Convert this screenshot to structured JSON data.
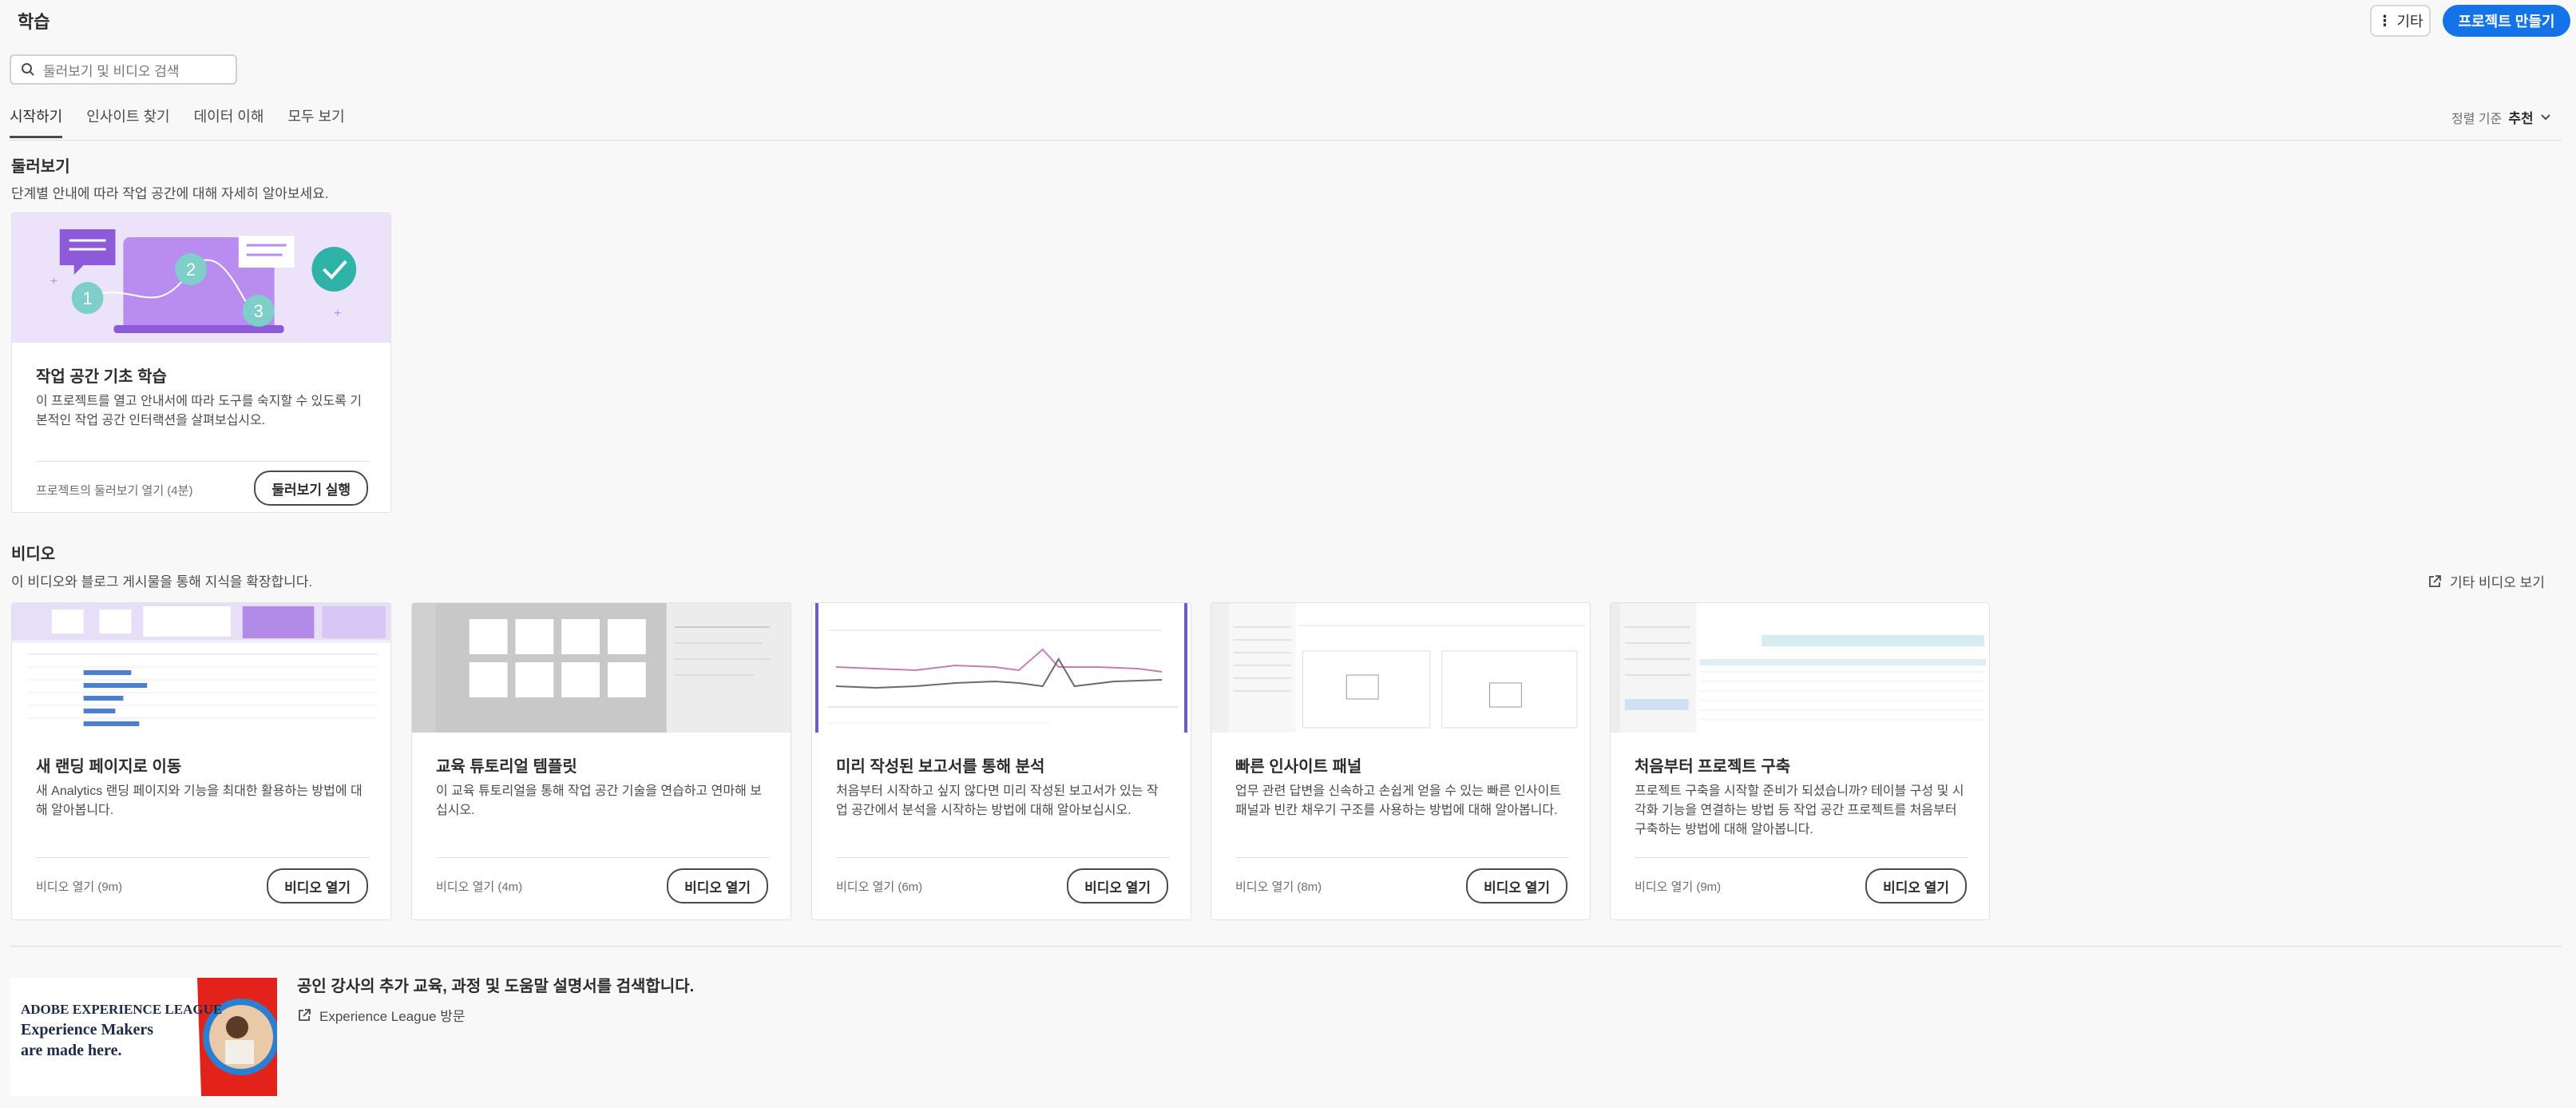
{
  "header": {
    "title": "학습",
    "more_label": "기타",
    "create_label": "프로젝트 만들기"
  },
  "search": {
    "placeholder": "둘러보기 및 비디오 검색"
  },
  "tabs": [
    {
      "label": "시작하기"
    },
    {
      "label": "인사이트 찾기"
    },
    {
      "label": "데이터 이해"
    },
    {
      "label": "모두 보기"
    }
  ],
  "sort": {
    "label": "정렬 기준",
    "value": "추천"
  },
  "tours": {
    "heading": "둘러보기",
    "subheading": "단계별 안내에 따라 작업 공간에 대해 자세히 알아보세요.",
    "card": {
      "title": "작업 공간 기초 학습",
      "desc": "이 프로젝트를 열고 안내서에 따라 도구를 숙지할 수 있도록 기본적인 작업 공간 인터랙션을 살펴보십시오.",
      "meta": "프로젝트의 둘러보기 열기 (4분)",
      "button": "둘러보기 실행"
    }
  },
  "videos": {
    "heading": "비디오",
    "subheading": "이 비디오와 블로그 게시물을 통해 지식을 확장합니다.",
    "more_link": "기타 비디오 보기",
    "cards": [
      {
        "title": "새 랜딩 페이지로 이동",
        "desc": "새 Analytics 랜딩 페이지와 기능을 최대한 활용하는 방법에 대해 알아봅니다.",
        "meta": "비디오 열기 (9m)",
        "button": "비디오 열기"
      },
      {
        "title": "교육 튜토리얼 템플릿",
        "desc": "이 교육 튜토리얼을 통해 작업 공간 기술을 연습하고 연마해 보십시오.",
        "meta": "비디오 열기 (4m)",
        "button": "비디오 열기"
      },
      {
        "title": "미리 작성된 보고서를 통해 분석",
        "desc": "처음부터 시작하고 싶지 않다면 미리 작성된 보고서가 있는 작업 공간에서 분석을 시작하는 방법에 대해 알아보십시오.",
        "meta": "비디오 열기 (6m)",
        "button": "비디오 열기"
      },
      {
        "title": "빠른 인사이트 패널",
        "desc": "업무 관련 답변을 신속하고 손쉽게 얻을 수 있는 빠른 인사이트 패널과 빈칸 채우기 구조를 사용하는 방법에 대해 알아봅니다.",
        "meta": "비디오 열기 (8m)",
        "button": "비디오 열기"
      },
      {
        "title": "처음부터 프로젝트 구축",
        "desc": "프로젝트 구축을 시작할 준비가 되셨습니까? 테이블 구성 및 시각화 기능을 연결하는 방법 등 작업 공간 프로젝트를 처음부터 구축하는 방법에 대해 알아봅니다.",
        "meta": "비디오 열기 (9m)",
        "button": "비디오 열기"
      }
    ]
  },
  "promo": {
    "banner_line1": "ADOBE EXPERIENCE LEAGUE",
    "banner_line2": "Experience Makers",
    "banner_line3": "are made here.",
    "title": "공인 강사의 추가 교육, 과정 및 도움말 설명서를 검색합니다.",
    "link": "Experience League 방문"
  },
  "colors": {
    "accent": "#1473e6",
    "tour_bg": "#ece3fb",
    "promo_red": "#e3231b"
  },
  "icons": [
    "more-icon",
    "search-icon",
    "chevron-down-icon",
    "external-link-icon"
  ]
}
